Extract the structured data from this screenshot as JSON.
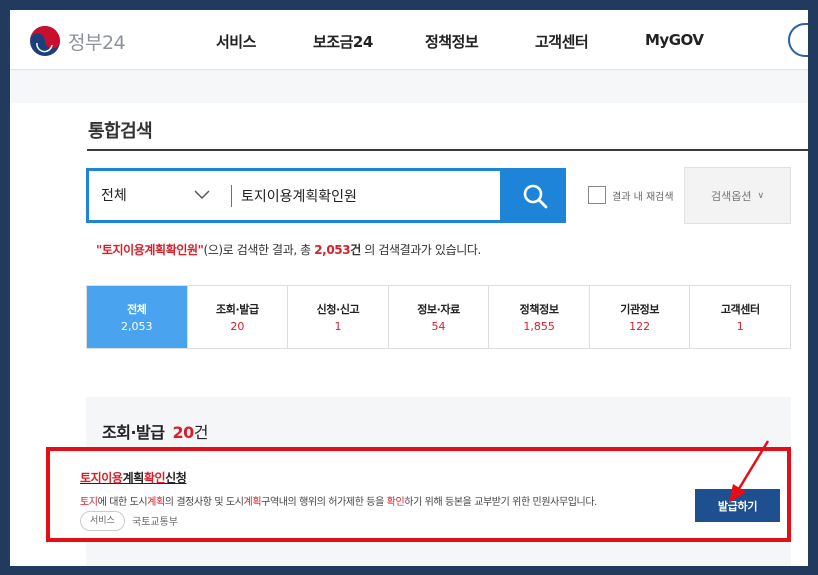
{
  "header": {
    "logo_text": "정부24",
    "nav": [
      "서비스",
      "보조금24",
      "정책정보",
      "고객센터",
      "MyGOV"
    ]
  },
  "page": {
    "title": "통합검색"
  },
  "search": {
    "scope": "전체",
    "query": "토지이용계획확인원",
    "recheck_label": "결과 내 재검색",
    "options_label": "검색옵션"
  },
  "summary": {
    "keyword": "\"토지이용계획확인원\"",
    "text_1": "(으)로 검색한 결과, 총 ",
    "count": "2,053",
    "text_2": "건",
    "text_3": " 의 검색결과가 있습니다."
  },
  "tabs": [
    {
      "label": "전체",
      "count": "2,053",
      "active": true
    },
    {
      "label": "조회·발급",
      "count": "20",
      "active": false
    },
    {
      "label": "신청·신고",
      "count": "1",
      "active": false
    },
    {
      "label": "정보·자료",
      "count": "54",
      "active": false
    },
    {
      "label": "정책정보",
      "count": "1,855",
      "active": false
    },
    {
      "label": "기관정보",
      "count": "122",
      "active": false
    },
    {
      "label": "고객센터",
      "count": "1",
      "active": false
    }
  ],
  "section": {
    "title": "조회·발급",
    "count": "20",
    "unit": "건"
  },
  "result": {
    "title_parts": [
      {
        "text": "토지이용",
        "hl": true
      },
      {
        "text": "계획",
        "hl": false
      },
      {
        "text": "확인",
        "hl": true
      },
      {
        "text": "신청",
        "hl": false
      }
    ],
    "desc_parts": [
      {
        "text": "토지",
        "hl": true
      },
      {
        "text": "에 대한 도시",
        "hl": false
      },
      {
        "text": "계획",
        "hl": true
      },
      {
        "text": "의 결정사항 및 도시",
        "hl": false
      },
      {
        "text": "계획",
        "hl": true
      },
      {
        "text": "구역내의 행위의 허가제한 등을 ",
        "hl": false
      },
      {
        "text": "확인",
        "hl": true
      },
      {
        "text": "하기 위해 등본을 교부받기 위한 민원사무입니다.",
        "hl": false
      }
    ],
    "tag": "서비스",
    "org": "국토교통부",
    "button_label": "발급하기"
  },
  "colors": {
    "accent_blue": "#1d84d7",
    "active_tab": "#4aa3ee",
    "highlight_red": "#d8202b",
    "button_navy": "#1e4f8e",
    "annotation_red": "#e50d16",
    "page_bg": "#213a5e"
  }
}
